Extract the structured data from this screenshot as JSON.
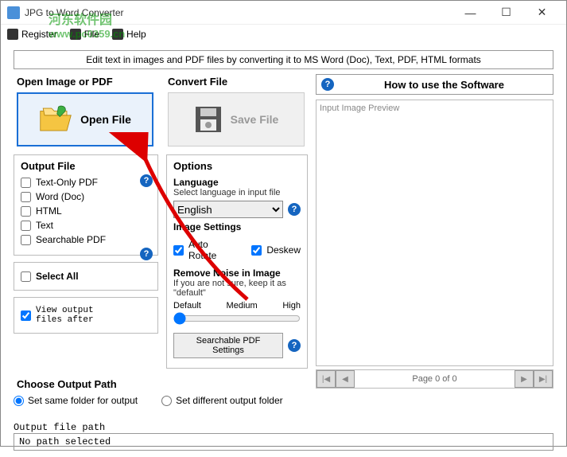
{
  "window": {
    "title": "JPG to Word Converter"
  },
  "menu": {
    "register": "Register",
    "file": "File",
    "help": "Help"
  },
  "watermark": {
    "line1": "河东软件园",
    "line2": "www.pc0359.cn"
  },
  "banner": "Edit text in images and PDF files by converting it to MS Word (Doc), Text, PDF, HTML formats",
  "open_group": {
    "title": "Open Image or PDF",
    "button": "Open File"
  },
  "convert_group": {
    "title": "Convert File",
    "button": "Save File"
  },
  "output_file": {
    "title": "Output File",
    "items": [
      "Text-Only PDF",
      "Word (Doc)",
      "HTML",
      "Text",
      "Searchable PDF"
    ]
  },
  "select_all": "Select All",
  "view_after": "View output\nfiles after",
  "options": {
    "title": "Options",
    "language_label": "Language",
    "language_sub": "Select language in input file",
    "language_value": "English",
    "image_settings": "Image Settings",
    "auto_rotate": "Auto Rotate",
    "deskew": "Deskew",
    "remove_noise": "Remove Noise in Image",
    "noise_sub": "If you are not sure, keep it as \"default\"",
    "slider": {
      "low": "Default",
      "mid": "Medium",
      "high": "High"
    },
    "searchable_btn": "Searchable PDF Settings"
  },
  "choose_path": {
    "title": "Choose Output Path",
    "same": "Set same folder for output",
    "diff": "Set different output folder"
  },
  "outpath": {
    "label": "Output file path",
    "value": "No path selected"
  },
  "howto": "How to use the Software",
  "preview_title": "Input Image Preview",
  "pager": "Page 0 of 0"
}
